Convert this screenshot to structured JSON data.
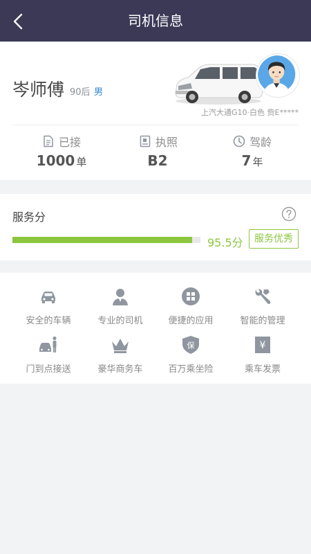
{
  "header": {
    "title": "司机信息",
    "back_icon": "chevron-left-icon"
  },
  "driver": {
    "name": "岑师傅",
    "age_group": "90后",
    "gender": "男",
    "car_info": "上汽大通G10·白色  赀E*****",
    "car_color": "#ffffff"
  },
  "stats": [
    {
      "label": "已接",
      "value": "1000",
      "unit": "单",
      "icon": "order-document-icon"
    },
    {
      "label": "执照",
      "value": "B2",
      "unit": "",
      "icon": "license-card-icon"
    },
    {
      "label": "驾龄",
      "value": "7",
      "unit": "年",
      "icon": "clock-icon"
    }
  ],
  "score": {
    "label": "服务分",
    "value_text": "95.5分",
    "progress_fraction": 0.955,
    "badge": "服务优秀",
    "accent_color": "#8cc63f"
  },
  "features": [
    {
      "label": "安全的车辆",
      "icon": "car-icon"
    },
    {
      "label": "专业的司机",
      "icon": "driver-person-icon"
    },
    {
      "label": "便捷的应用",
      "icon": "app-grid-icon"
    },
    {
      "label": "智能的管理",
      "icon": "wrench-icon"
    },
    {
      "label": "门到点接送",
      "icon": "door-pickup-icon"
    },
    {
      "label": "豪华商务车",
      "icon": "crown-icon"
    },
    {
      "label": "百万乘坐险",
      "icon": "insurance-shield-icon"
    },
    {
      "label": "乘车发票",
      "icon": "invoice-icon"
    }
  ],
  "colors": {
    "header_bg": "#3b3956",
    "icon_gray": "#8f96a0",
    "gender_blue": "#2f86d6"
  }
}
